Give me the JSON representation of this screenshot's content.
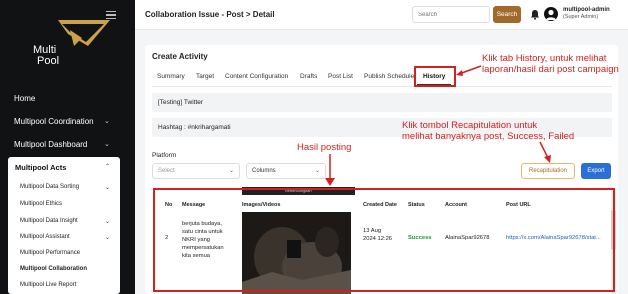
{
  "sidebar": {
    "brand": "Multi Pool",
    "brand_line1": "Multi",
    "brand_line2": "Pool",
    "items": [
      {
        "label": "Home"
      },
      {
        "label": "Multipool Coordination"
      },
      {
        "label": "Multipool Dashboard"
      }
    ],
    "section_title": "Multipool Acts",
    "sub_items": [
      {
        "label": "Multipool Data Sorting"
      },
      {
        "label": "Multipool Ethics"
      },
      {
        "label": "Multipool Data Insight"
      },
      {
        "label": "Multipool Assistant"
      },
      {
        "label": "Multipool Performance"
      },
      {
        "label": "Multipool Collaboration"
      },
      {
        "label": "Multipool Live Report"
      }
    ]
  },
  "header": {
    "breadcrumb": "Collaboration Issue - Post  >  Detail",
    "search_placeholder": "Search",
    "search_label": "Search",
    "user_name": "multipool-admin",
    "user_role": "(Super Admin)"
  },
  "card": {
    "title": "Create Activity",
    "tabs": [
      "Summary",
      "Target",
      "Content Configuration",
      "Drafts",
      "Post List",
      "Publish Schedule",
      "History"
    ],
    "campaign": "[Testing] Twitter",
    "hashtag": "Hashtag : #nkrihargamati",
    "platform_label": "Platform",
    "select_placeholder": "Select",
    "columns_label": "Columns",
    "recap_label": "Recapitulation",
    "export_label": "Export"
  },
  "table": {
    "headers": [
      "No",
      "Message",
      "Images/Videos",
      "Created Date",
      "Status",
      "Account",
      "Post URL"
    ],
    "media_caption": "berbincangkan",
    "rows": [
      {
        "no": "2",
        "message_lines": [
          "berjuta budaya,",
          "satu cinta untuk",
          "NKRI yang",
          "mempersatukan",
          "kita semua"
        ],
        "date_line1": "13 Aug",
        "date_line2": "2024 12:26",
        "status": "Success",
        "account": "AlainaSpar92678",
        "url": "https://x.com/AlainaSpar92678/stat..."
      }
    ]
  },
  "annotations": {
    "history_lines": [
      "Klik tab History, untuk melihat",
      "laporan/hasil dari post campaign"
    ],
    "recap_lines": [
      "Klik tombol Recapitulation untuk",
      "melihat banyaknya post, Success, Failed"
    ],
    "result": "Hasil posting"
  },
  "colors": {
    "accent": "#a06a2b",
    "annotation": "#d42020",
    "export": "#2a6fd6",
    "success": "#1a9a3a"
  }
}
